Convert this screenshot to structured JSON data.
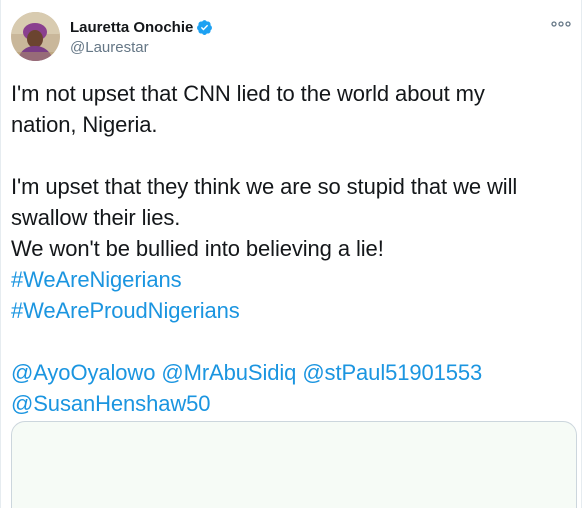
{
  "author": {
    "display_name": "Lauretta Onochie",
    "handle": "@Laurestar",
    "verified_icon": "verified-badge-icon",
    "avatar_icon": "profile-photo"
  },
  "menu": {
    "icon": "more-options-icon"
  },
  "tweet": {
    "line1": "I'm not upset that CNN lied to the world about my",
    "line2": "nation, Nigeria.",
    "line3": "I'm upset that they think we are so stupid that we will",
    "line4": "swallow their lies.",
    "line5": "We won't be bullied into believing a lie!",
    "hashtag1": "#WeAreNigerians",
    "hashtag2": "#WeAreProudNigerians",
    "mention1": "@AyoOyalowo",
    "mention2": "@MrAbuSidiq",
    "mention3": "@stPaul51901553",
    "mention4": "@SusanHenshaw50"
  },
  "colors": {
    "link": "#1b95e0",
    "verified": "#1da1f2",
    "text": "#14171a",
    "secondary": "#657786"
  }
}
